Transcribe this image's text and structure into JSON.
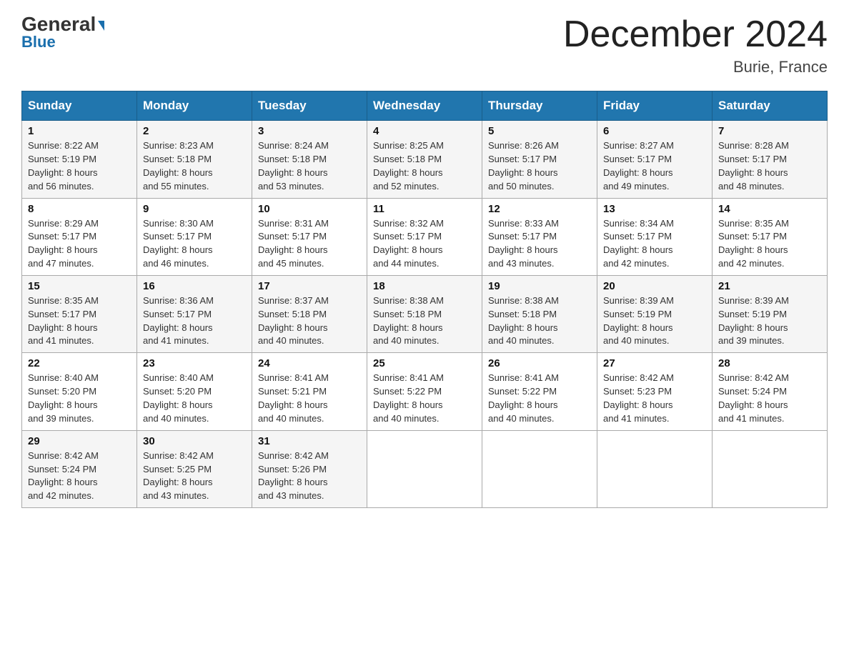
{
  "header": {
    "logo_general": "General",
    "logo_blue": "Blue",
    "month_title": "December 2024",
    "location": "Burie, France"
  },
  "days_of_week": [
    "Sunday",
    "Monday",
    "Tuesday",
    "Wednesday",
    "Thursday",
    "Friday",
    "Saturday"
  ],
  "weeks": [
    [
      {
        "day": "1",
        "sunrise": "8:22 AM",
        "sunset": "5:19 PM",
        "daylight": "8 hours and 56 minutes."
      },
      {
        "day": "2",
        "sunrise": "8:23 AM",
        "sunset": "5:18 PM",
        "daylight": "8 hours and 55 minutes."
      },
      {
        "day": "3",
        "sunrise": "8:24 AM",
        "sunset": "5:18 PM",
        "daylight": "8 hours and 53 minutes."
      },
      {
        "day": "4",
        "sunrise": "8:25 AM",
        "sunset": "5:18 PM",
        "daylight": "8 hours and 52 minutes."
      },
      {
        "day": "5",
        "sunrise": "8:26 AM",
        "sunset": "5:17 PM",
        "daylight": "8 hours and 50 minutes."
      },
      {
        "day": "6",
        "sunrise": "8:27 AM",
        "sunset": "5:17 PM",
        "daylight": "8 hours and 49 minutes."
      },
      {
        "day": "7",
        "sunrise": "8:28 AM",
        "sunset": "5:17 PM",
        "daylight": "8 hours and 48 minutes."
      }
    ],
    [
      {
        "day": "8",
        "sunrise": "8:29 AM",
        "sunset": "5:17 PM",
        "daylight": "8 hours and 47 minutes."
      },
      {
        "day": "9",
        "sunrise": "8:30 AM",
        "sunset": "5:17 PM",
        "daylight": "8 hours and 46 minutes."
      },
      {
        "day": "10",
        "sunrise": "8:31 AM",
        "sunset": "5:17 PM",
        "daylight": "8 hours and 45 minutes."
      },
      {
        "day": "11",
        "sunrise": "8:32 AM",
        "sunset": "5:17 PM",
        "daylight": "8 hours and 44 minutes."
      },
      {
        "day": "12",
        "sunrise": "8:33 AM",
        "sunset": "5:17 PM",
        "daylight": "8 hours and 43 minutes."
      },
      {
        "day": "13",
        "sunrise": "8:34 AM",
        "sunset": "5:17 PM",
        "daylight": "8 hours and 42 minutes."
      },
      {
        "day": "14",
        "sunrise": "8:35 AM",
        "sunset": "5:17 PM",
        "daylight": "8 hours and 42 minutes."
      }
    ],
    [
      {
        "day": "15",
        "sunrise": "8:35 AM",
        "sunset": "5:17 PM",
        "daylight": "8 hours and 41 minutes."
      },
      {
        "day": "16",
        "sunrise": "8:36 AM",
        "sunset": "5:17 PM",
        "daylight": "8 hours and 41 minutes."
      },
      {
        "day": "17",
        "sunrise": "8:37 AM",
        "sunset": "5:18 PM",
        "daylight": "8 hours and 40 minutes."
      },
      {
        "day": "18",
        "sunrise": "8:38 AM",
        "sunset": "5:18 PM",
        "daylight": "8 hours and 40 minutes."
      },
      {
        "day": "19",
        "sunrise": "8:38 AM",
        "sunset": "5:18 PM",
        "daylight": "8 hours and 40 minutes."
      },
      {
        "day": "20",
        "sunrise": "8:39 AM",
        "sunset": "5:19 PM",
        "daylight": "8 hours and 40 minutes."
      },
      {
        "day": "21",
        "sunrise": "8:39 AM",
        "sunset": "5:19 PM",
        "daylight": "8 hours and 39 minutes."
      }
    ],
    [
      {
        "day": "22",
        "sunrise": "8:40 AM",
        "sunset": "5:20 PM",
        "daylight": "8 hours and 39 minutes."
      },
      {
        "day": "23",
        "sunrise": "8:40 AM",
        "sunset": "5:20 PM",
        "daylight": "8 hours and 40 minutes."
      },
      {
        "day": "24",
        "sunrise": "8:41 AM",
        "sunset": "5:21 PM",
        "daylight": "8 hours and 40 minutes."
      },
      {
        "day": "25",
        "sunrise": "8:41 AM",
        "sunset": "5:22 PM",
        "daylight": "8 hours and 40 minutes."
      },
      {
        "day": "26",
        "sunrise": "8:41 AM",
        "sunset": "5:22 PM",
        "daylight": "8 hours and 40 minutes."
      },
      {
        "day": "27",
        "sunrise": "8:42 AM",
        "sunset": "5:23 PM",
        "daylight": "8 hours and 41 minutes."
      },
      {
        "day": "28",
        "sunrise": "8:42 AM",
        "sunset": "5:24 PM",
        "daylight": "8 hours and 41 minutes."
      }
    ],
    [
      {
        "day": "29",
        "sunrise": "8:42 AM",
        "sunset": "5:24 PM",
        "daylight": "8 hours and 42 minutes."
      },
      {
        "day": "30",
        "sunrise": "8:42 AM",
        "sunset": "5:25 PM",
        "daylight": "8 hours and 43 minutes."
      },
      {
        "day": "31",
        "sunrise": "8:42 AM",
        "sunset": "5:26 PM",
        "daylight": "8 hours and 43 minutes."
      },
      null,
      null,
      null,
      null
    ]
  ],
  "labels": {
    "sunrise": "Sunrise:",
    "sunset": "Sunset:",
    "daylight": "Daylight:"
  }
}
